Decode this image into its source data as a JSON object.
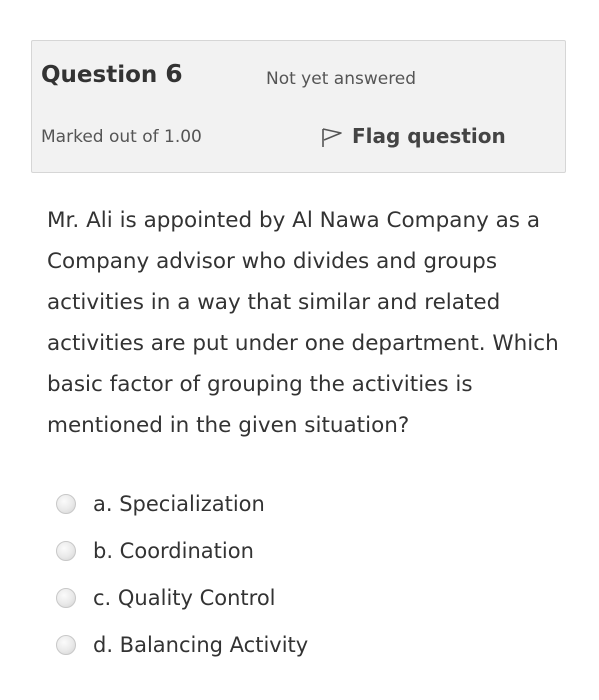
{
  "info": {
    "question_label": "Question",
    "question_number": "6",
    "state": "Not yet answered",
    "grade": "Marked out of 1.00",
    "flag_label": "Flag question",
    "flag_icon": "flag-outline-icon"
  },
  "question": {
    "text": "Mr. Ali is appointed by Al Nawa Company as a Company advisor who divides and groups activities in a way that similar and related activities are put under one department. Which basic factor of grouping the activities is mentioned in the given situation?"
  },
  "answers": [
    {
      "label": "a. Specialization",
      "selected": false
    },
    {
      "label": "b. Coordination",
      "selected": false
    },
    {
      "label": "c. Quality Control",
      "selected": false
    },
    {
      "label": "d. Balancing Activity",
      "selected": false
    }
  ],
  "colors": {
    "info_background": "#f2f2f2",
    "info_border": "#d6d6d6",
    "text": "#333333"
  }
}
